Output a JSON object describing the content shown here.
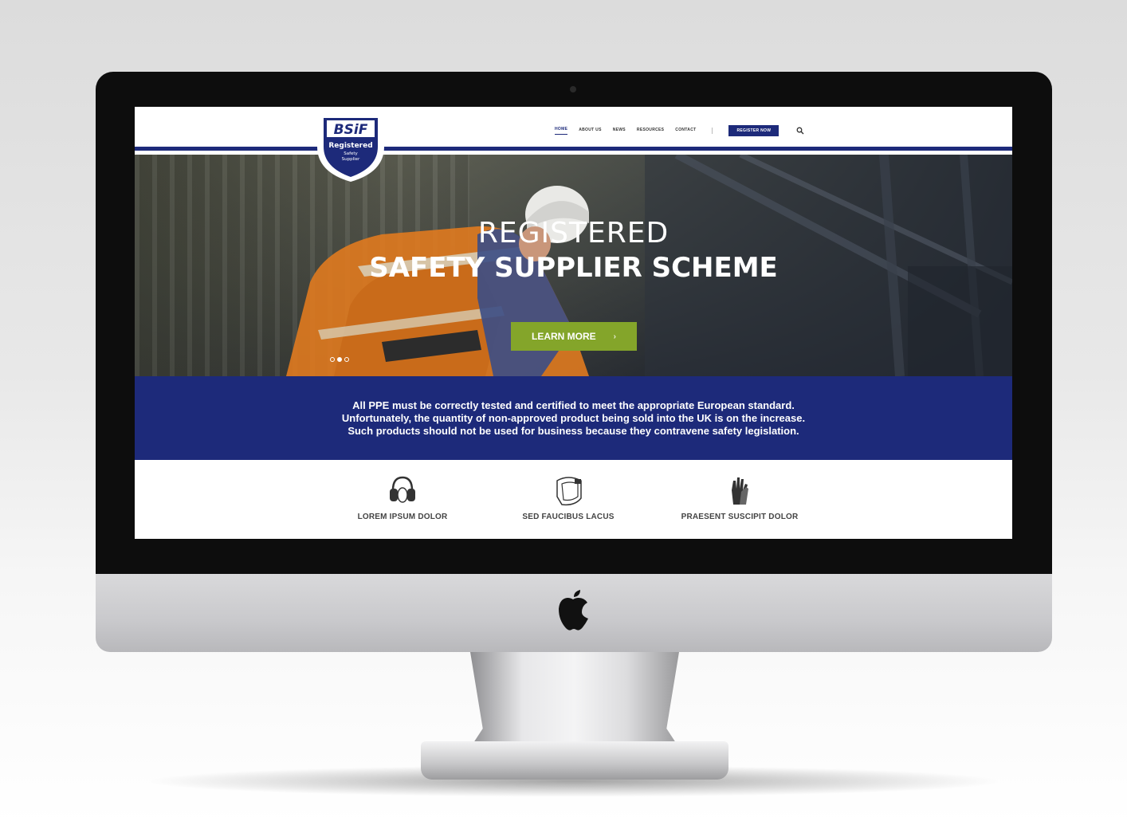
{
  "logo": {
    "brand": "BSiF",
    "line1": "Registered",
    "line2": "Safety",
    "line3": "Supplier"
  },
  "nav": {
    "items": [
      {
        "label": "HOME",
        "active": true
      },
      {
        "label": "ABOUT US",
        "active": false
      },
      {
        "label": "NEWS",
        "active": false
      },
      {
        "label": "RESOURCES",
        "active": false
      },
      {
        "label": "CONTACT",
        "active": false
      }
    ],
    "register_label": "REGISTER NOW",
    "search_icon": "search-icon"
  },
  "hero": {
    "title_light": "REGISTERED",
    "title_bold": "SAFETY SUPPLIER SCHEME",
    "button_label": "LEARN MORE",
    "button_arrow": "›",
    "slide_count": 3,
    "active_slide": 2
  },
  "info": {
    "line1": "All PPE must be correctly tested and certified to meet the appropriate European standard.",
    "line2": "Unfortunately, the quantity of non-approved product being sold into the UK is on the increase.",
    "line3": "Such products should not be used for business because they contravene safety legislation."
  },
  "features": [
    {
      "label": "LOREM IPSUM DOLOR",
      "icon": "ear-defenders-icon"
    },
    {
      "label": "SED FAUCIBUS LACUS",
      "icon": "face-shield-icon"
    },
    {
      "label": "PRAESENT SUSCIPIT DOLOR",
      "icon": "gloves-icon"
    }
  ],
  "colors": {
    "brand_navy": "#1d2a7a",
    "accent_green": "#84a52a"
  },
  "device": {
    "brand_icon": "apple-logo-icon"
  }
}
